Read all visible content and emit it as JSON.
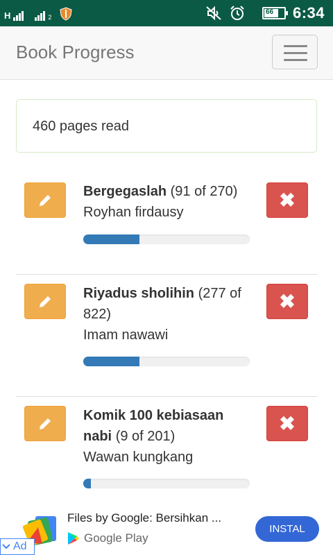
{
  "status_bar": {
    "time": "6:34",
    "battery": "66",
    "signal_labels": [
      "H",
      "2"
    ]
  },
  "navbar": {
    "brand": "Book Progress"
  },
  "summary": {
    "text": "460 pages read"
  },
  "books": [
    {
      "title": "Bergegaslah",
      "progress_text": "(91 of 270)",
      "author": "Royhan firdausy",
      "progress": 0.337
    },
    {
      "title": "Riyadus sholihin",
      "progress_text": "(277 of 822)",
      "author": "Imam nawawi",
      "progress": 0.337
    },
    {
      "title": "Komik 100 kebiasaan nabi",
      "progress_text": "(9 of 201)",
      "author": "Wawan kungkang",
      "progress": 0.045
    }
  ],
  "ad": {
    "title": "Files by Google: Bersihkan ...",
    "store": "Google Play",
    "install_label": "INSTAL",
    "ad_label": "Ad"
  },
  "colors": {
    "status_bar": "#0b5a45",
    "edit": "#f0ad4e",
    "delete": "#d9534f",
    "progress": "#337ab7",
    "install": "#3367d6"
  }
}
